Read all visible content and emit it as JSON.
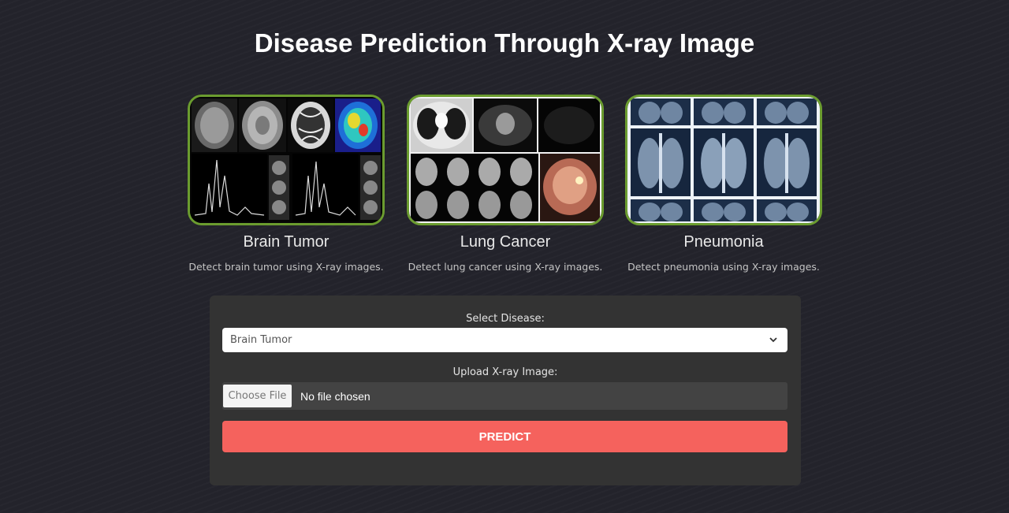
{
  "header": {
    "title": "Disease Prediction Through X-ray Image"
  },
  "cards": [
    {
      "title": "Brain Tumor",
      "description": "Detect brain tumor using X-ray images.",
      "image": "brain-mri-scans"
    },
    {
      "title": "Lung Cancer",
      "description": "Detect lung cancer using X-ray images.",
      "image": "lung-ct-scans"
    },
    {
      "title": "Pneumonia",
      "description": "Detect pneumonia using X-ray images.",
      "image": "chest-xray-grid"
    }
  ],
  "form": {
    "select_label": "Select Disease:",
    "selected_disease": "Brain Tumor",
    "upload_label": "Upload X-ray Image:",
    "choose_file_label": "Choose File",
    "file_status": "No file chosen",
    "predict_label": "PREDICT"
  },
  "colors": {
    "background": "#23232b",
    "card_border": "#6b9c2f",
    "panel": "#333333",
    "predict_button": "#f5625d"
  },
  "icons": {
    "select_chevron": "chevron-down-icon"
  }
}
